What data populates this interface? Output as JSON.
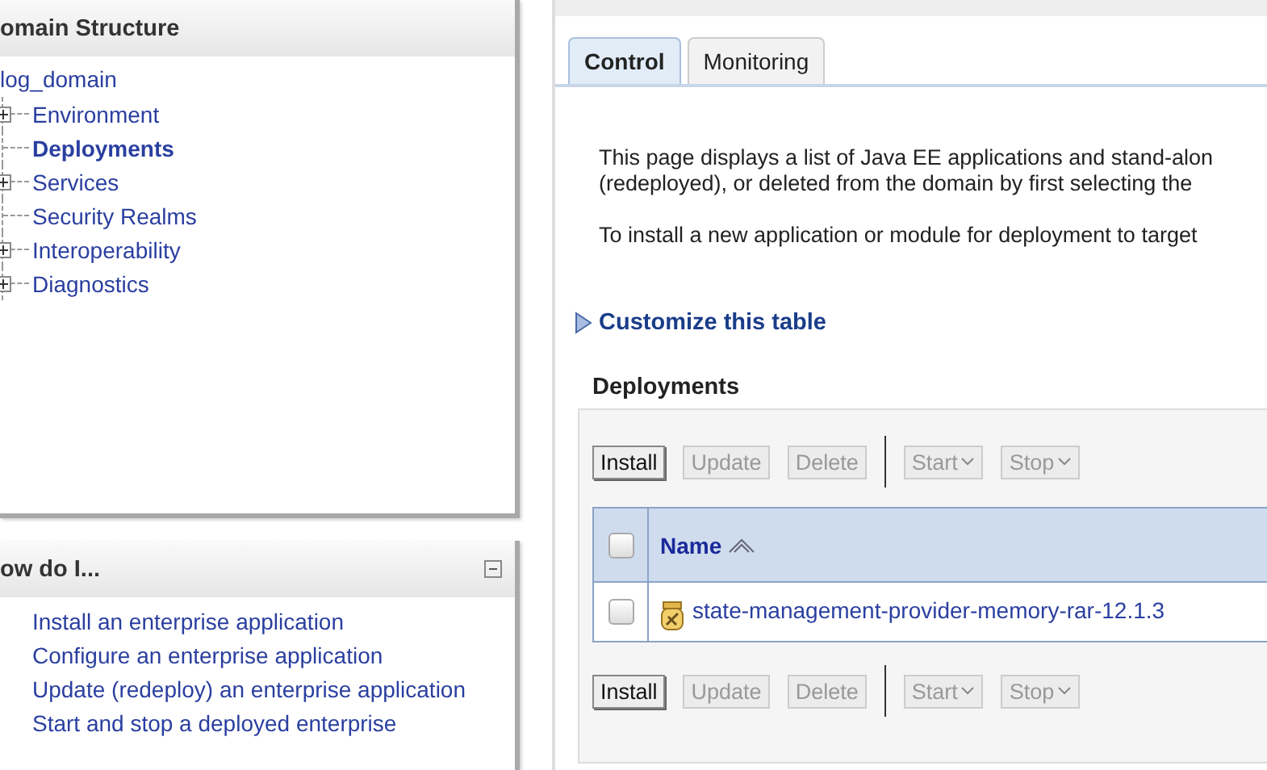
{
  "domain_structure": {
    "title": "omain Structure",
    "root": "log_domain",
    "items": [
      {
        "label": "Environment",
        "expandable": true,
        "selected": false
      },
      {
        "label": "Deployments",
        "expandable": false,
        "selected": true
      },
      {
        "label": "Services",
        "expandable": true,
        "selected": false
      },
      {
        "label": "Security Realms",
        "expandable": false,
        "selected": false
      },
      {
        "label": "Interoperability",
        "expandable": true,
        "selected": false
      },
      {
        "label": "Diagnostics",
        "expandable": true,
        "selected": false
      }
    ]
  },
  "how_do_i": {
    "title": "ow do I...",
    "links": [
      "Install an enterprise application",
      "Configure an enterprise application",
      "Update (redeploy) an enterprise application",
      "Start and stop a deployed enterprise"
    ]
  },
  "tabs": [
    {
      "label": "Control",
      "selected": true
    },
    {
      "label": "Monitoring",
      "selected": false
    }
  ],
  "description": [
    "This page displays a list of Java EE applications and stand-alon",
    "(redeployed), or deleted from the domain by first selecting the",
    "To install a new application or module for deployment to target"
  ],
  "customize_link": "Customize this table",
  "table": {
    "title": "Deployments",
    "top_toolbar": [
      {
        "label": "Install",
        "kind": "button",
        "disabled": false
      },
      {
        "label": "Update",
        "kind": "button",
        "disabled": true
      },
      {
        "label": "Delete",
        "kind": "button",
        "disabled": true
      },
      {
        "label": "Start",
        "kind": "dropdown",
        "disabled": true
      },
      {
        "label": "Stop",
        "kind": "dropdown",
        "disabled": true
      }
    ],
    "select_all_checked": false,
    "columns": [
      {
        "label": "Name"
      }
    ],
    "rows": [
      {
        "name": "state-management-provider-memory-rar-12.1.3",
        "checked": false
      }
    ],
    "bottom_toolbar": [
      {
        "label": "Install",
        "kind": "button",
        "disabled": false
      },
      {
        "label": "Update",
        "kind": "button",
        "disabled": true
      },
      {
        "label": "Delete",
        "kind": "button",
        "disabled": true
      },
      {
        "label": "Start",
        "kind": "dropdown",
        "disabled": true
      },
      {
        "label": "Stop",
        "kind": "dropdown",
        "disabled": true
      }
    ]
  }
}
